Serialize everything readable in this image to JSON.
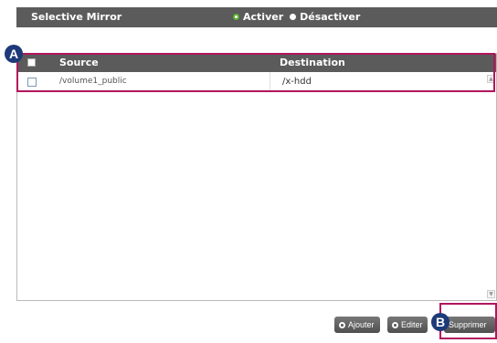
{
  "header": {
    "title": "Selective Mirror",
    "options": [
      {
        "label": "Activer",
        "checked": true
      },
      {
        "label": "Désactiver",
        "checked": false
      }
    ]
  },
  "table": {
    "columns": [
      "Source",
      "Destination"
    ],
    "rows": [
      {
        "source": "/volume1_public",
        "destination": "/x-hdd"
      }
    ]
  },
  "buttons": {
    "add": "Ajouter",
    "edit": "Editer",
    "delete": "Supprimer"
  },
  "callouts": {
    "a": "A",
    "b": "B"
  },
  "colors": {
    "header_bg": "#5b5b5b",
    "callout_border": "#b2155d",
    "badge_bg": "#1d3a78",
    "radio_accent": "#5cb531"
  }
}
